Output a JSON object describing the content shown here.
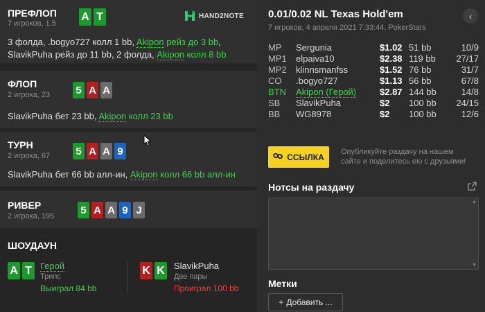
{
  "logo": {
    "text": "HAND2NOTE",
    "icon": "h2n-logo-icon"
  },
  "streets": {
    "preflop": {
      "title": "ПРЕФЛОП",
      "sub": "7 игроков, 1.5",
      "cards": [
        {
          "rank": "A",
          "color": "#1c9a2e"
        },
        {
          "rank": "T",
          "color": "#1c9a2e"
        }
      ],
      "line1": {
        "a": "3 фолда, .bogyo727 ",
        "b": "колл 1 bb",
        "c": ", ",
        "d": "Akipon",
        "e": " рейз до 3 bb",
        "f": ","
      },
      "line2": {
        "a": "SlavikPuha ",
        "b": "рейз до 11 bb",
        "c": ", 2 фолда, ",
        "d": "Akipon",
        "e": " колл 8 bb"
      }
    },
    "flop": {
      "title": "ФЛОП",
      "sub": "2 игрока, 23",
      "cards": [
        {
          "rank": "5",
          "color": "#1c9a2e"
        },
        {
          "rank": "A",
          "color": "#b41f1f"
        },
        {
          "rank": "A",
          "color": "#6b6b6b"
        }
      ],
      "line": {
        "a": "SlavikPuha ",
        "b": "бет 23 bb",
        "c": ", ",
        "d": "Akipon",
        "e": " колл 23 bb"
      }
    },
    "turn": {
      "title": "ТУРН",
      "sub": "2 игрока, 67",
      "cards": [
        {
          "rank": "5",
          "color": "#1c9a2e"
        },
        {
          "rank": "A",
          "color": "#b41f1f"
        },
        {
          "rank": "A",
          "color": "#6b6b6b"
        },
        {
          "rank": "9",
          "color": "#1f63c0"
        }
      ],
      "line": {
        "a": "SlavikPuha ",
        "b": "бет 66 bb алл-ин",
        "c": ", ",
        "d": "Akipon",
        "e": " колл 66 bb алл-ин"
      }
    },
    "river": {
      "title": "РИВЕР",
      "sub": "2 игрока, 195",
      "cards": [
        {
          "rank": "5",
          "color": "#1c9a2e"
        },
        {
          "rank": "A",
          "color": "#b41f1f"
        },
        {
          "rank": "A",
          "color": "#6b6b6b"
        },
        {
          "rank": "9",
          "color": "#1f63c0"
        },
        {
          "rank": "J",
          "color": "#6b6b6b"
        }
      ]
    }
  },
  "showdown": {
    "title": "ШОУДАУН",
    "hero": {
      "name": "Герой",
      "hand": "Трипс",
      "result": "Выиграл 84 bb",
      "cards": [
        {
          "rank": "A",
          "color": "#1c9a2e"
        },
        {
          "rank": "T",
          "color": "#1c9a2e"
        }
      ]
    },
    "villain": {
      "name": "SlavikPuha",
      "hand": "Две пары",
      "result": "Проиграл 100 bb",
      "cards": [
        {
          "rank": "K",
          "color": "#b41f1f"
        },
        {
          "rank": "K",
          "color": "#1c9a2e"
        }
      ]
    }
  },
  "game": {
    "title": "0.01/0.02 NL Texas Hold'em",
    "sub": "7 игроков, 4 апреля 2021 7:33:44, PokerStars",
    "collapse_icon": "chevron-left-icon"
  },
  "players": [
    {
      "pos": "MP",
      "name": "Sergunia",
      "stack": "$1.02",
      "bb": "51 bb",
      "rec": "10/9"
    },
    {
      "pos": "MP1",
      "name": "elpaiva10",
      "stack": "$2.38",
      "bb": "119 bb",
      "rec": "27/17"
    },
    {
      "pos": "MP2",
      "name": "klinnsmanfss",
      "stack": "$1.52",
      "bb": "76 bb",
      "rec": "31/7"
    },
    {
      "pos": "CO",
      "name": ".bogyo727",
      "stack": "$1.13",
      "bb": "56 bb",
      "rec": "67/8"
    },
    {
      "pos": "BTN",
      "name": "Akipon (Герой)",
      "stack": "$2.87",
      "bb": "144 bb",
      "rec": "14/8",
      "hero": true
    },
    {
      "pos": "SB",
      "name": "SlavikPuha",
      "stack": "$2",
      "bb": "100 bb",
      "rec": "24/15"
    },
    {
      "pos": "BB",
      "name": "WG8978",
      "stack": "$2",
      "bb": "100 bb",
      "rec": "12/6"
    }
  ],
  "share": {
    "button_label": "ССЫЛКА",
    "hint_line1": "Опубликуйте раздачу на нашем",
    "hint_line2": "сайте и поделитесь ею с друзьями!"
  },
  "notes": {
    "title": "Нотсы на раздачу",
    "value": ""
  },
  "tags": {
    "title": "Метки",
    "add_label": "Добавить ...",
    "add_icon": "plus-icon"
  }
}
